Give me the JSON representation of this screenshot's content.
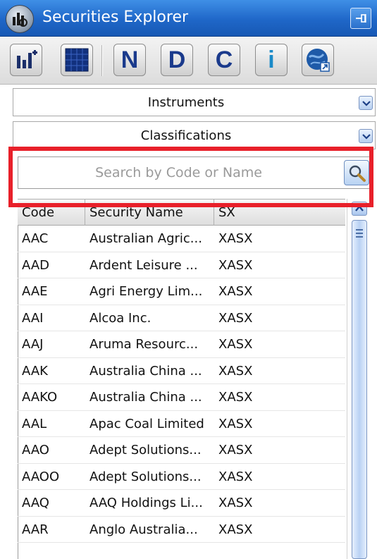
{
  "window": {
    "title": "Securities Explorer"
  },
  "toolbar": {
    "buttons": [
      {
        "icon": "bar-chart-icon"
      },
      {
        "icon": "grid-view-icon"
      },
      {
        "label": "N"
      },
      {
        "label": "D"
      },
      {
        "label": "C"
      },
      {
        "label": "i"
      },
      {
        "icon": "globe-export-icon"
      }
    ]
  },
  "sections": {
    "instruments": "Instruments",
    "classifications": "Classifications"
  },
  "search": {
    "placeholder": "Search by Code or Name",
    "value": ""
  },
  "highlight_color": "#e8202a",
  "table": {
    "columns": [
      "Code",
      "Security Name",
      "SX"
    ],
    "rows": [
      [
        "AAC",
        "Australian Agric...",
        "XASX"
      ],
      [
        "AAD",
        "Ardent Leisure ...",
        "XASX"
      ],
      [
        "AAE",
        "Agri Energy Lim...",
        "XASX"
      ],
      [
        "AAI",
        "Alcoa Inc.",
        "XASX"
      ],
      [
        "AAJ",
        "Aruma Resourc...",
        "XASX"
      ],
      [
        "AAK",
        "Australia China ...",
        "XASX"
      ],
      [
        "AAKO",
        "Australia China ...",
        "XASX"
      ],
      [
        "AAL",
        "Apac Coal Limited",
        "XASX"
      ],
      [
        "AAO",
        "Adept Solutions...",
        "XASX"
      ],
      [
        "AAOO",
        "Adept Solutions...",
        "XASX"
      ],
      [
        "AAQ",
        "AAQ Holdings Li...",
        "XASX"
      ],
      [
        "AAR",
        "Anglo Australia...",
        "XASX"
      ]
    ]
  }
}
